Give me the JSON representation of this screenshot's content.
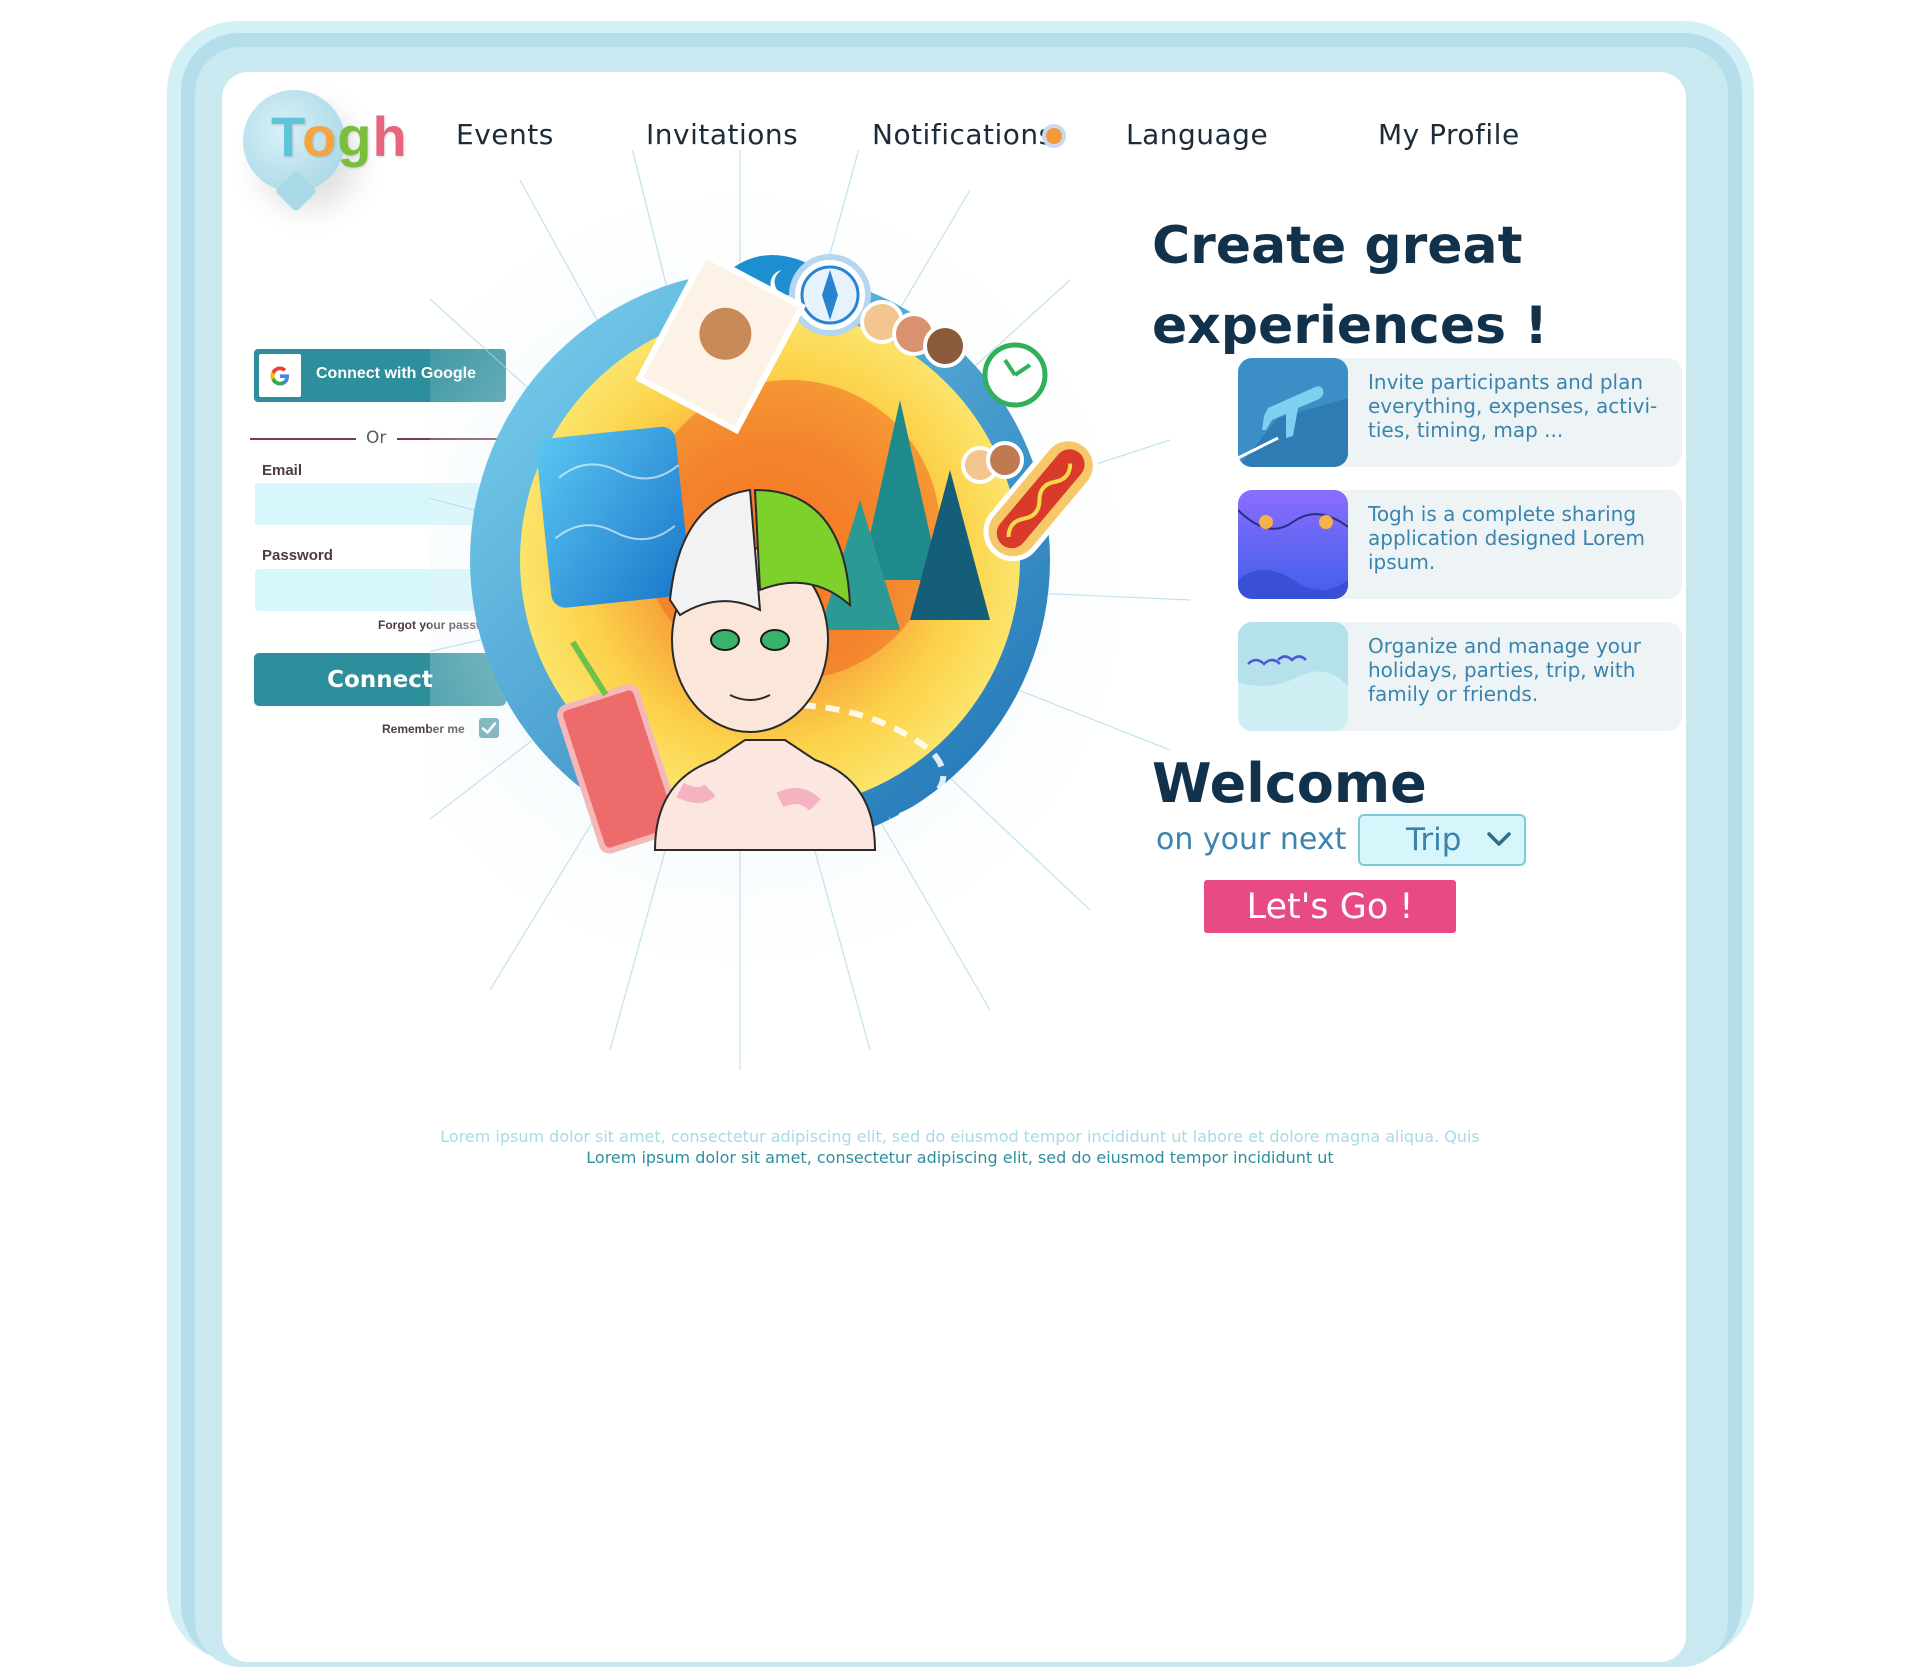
{
  "brand": {
    "logo_text_parts": [
      "T",
      "o",
      "g",
      "h"
    ]
  },
  "nav": {
    "events": "Events",
    "invitations": "Invitations",
    "notifications": "Notifications",
    "language": "Language",
    "my_profile": "My Profile"
  },
  "login": {
    "google_label": "Connect with Google",
    "or_label": "Or",
    "email_label": "Email",
    "email_value": "",
    "password_label": "Password",
    "password_value": "",
    "forgot_label": "Forgot your password",
    "connect_label": "Connect",
    "remember_label": "Remember me",
    "remember_checked": true
  },
  "hero": {
    "headline_line1": "Create great",
    "headline_line2": "experiences !"
  },
  "features": [
    {
      "icon": "airplane-icon",
      "text": "Invite participants and plan everything, expenses, activi-ties, timing, map ..."
    },
    {
      "icon": "string-lights-icon",
      "text": "Togh is a  complete sharing application designed Lorem ipsum."
    },
    {
      "icon": "birds-sky-icon",
      "text": "Organize and manage your holidays, parties, trip, with family or friends."
    }
  ],
  "welcome": {
    "title": "Welcome",
    "subtitle": "on your next",
    "trip_selected": "Trip",
    "cta_label": "Let's Go !"
  },
  "footer": {
    "line1": "Lorem ipsum dolor sit amet, consectetur adipiscing elit, sed do eiusmod tempor incididunt ut labore et dolore magna aliqua. Quis",
    "line2": "Lorem ipsum dolor sit amet, consectetur adipiscing elit, sed do eiusmod tempor incididunt ut"
  },
  "colors": {
    "teal": "#2e8f9c",
    "navy": "#12314a",
    "pink": "#e84a86",
    "light_cyan": "#d6f6fc",
    "frame": "#b4dfea"
  }
}
